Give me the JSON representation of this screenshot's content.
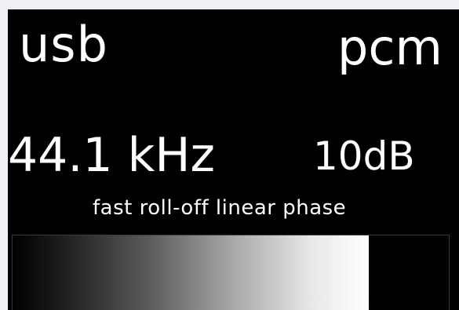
{
  "display": {
    "input": "usb",
    "format": "pcm",
    "sample_rate": "44.1 kHz",
    "volume": "10dB",
    "filter": "fast roll-off linear phase"
  },
  "meter": {
    "level": 0.817
  },
  "colors": {
    "screen_background": "#000000",
    "text": "#ffffff",
    "page_background": "#eef0f3"
  }
}
